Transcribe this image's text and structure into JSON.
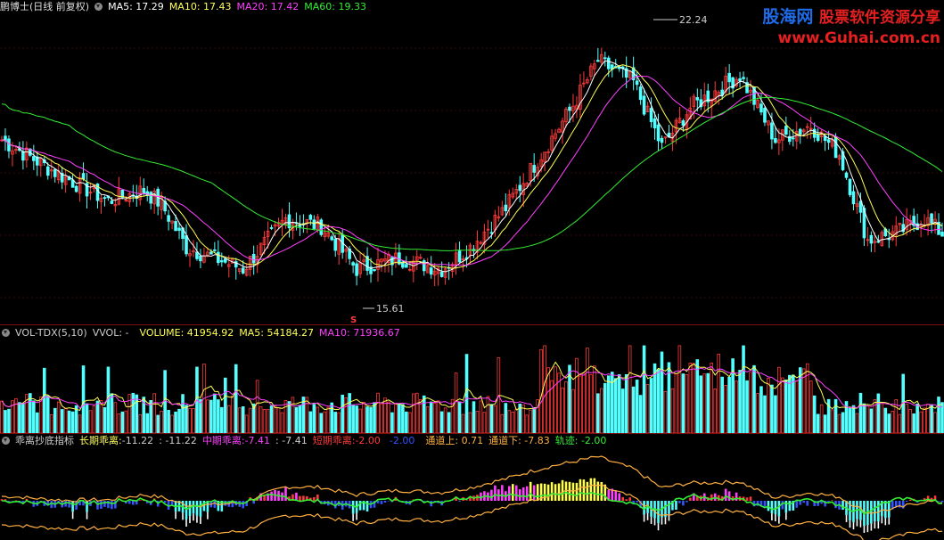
{
  "price_panel": {
    "stock_name": "鹏博士",
    "period": "(日线 前复权)",
    "ma5": "MA5: 17.29",
    "ma10": "MA10: 17.43",
    "ma20": "MA20: 17.42",
    "ma60": "MA60: 19.33",
    "high_label": "22.24",
    "low_label": "15.61",
    "signal_mark": "S",
    "colors": {
      "ma5": "#ffffff",
      "ma10": "#ffff55",
      "ma20": "#ff40ff",
      "ma60": "#33ee33",
      "up": "#ff3a3a",
      "down": "#54ffff"
    }
  },
  "volume_panel": {
    "name": "VOL-TDX(5,10)",
    "vvol": "VVOL: -",
    "volume": "VOLUME: 41954.92",
    "ma5": "MA5: 54184.27",
    "ma10": "MA10: 71936.67"
  },
  "indicator_panel": {
    "name": "乖离抄底指标",
    "long_label": "长期乖离:",
    "long_value": "-11.22",
    "colon_value": ": -11.22",
    "mid_label": "中期乖离:",
    "mid_value": "-7.41",
    "mid_colon_value": ": -7.41",
    "short_label": "短期乖离:",
    "short_value": "-2.00",
    "short_colon_value": "-2.00",
    "channel_up": "通道上: 0.71",
    "channel_down": "通道下: -7.83",
    "track": "轨迹: -2.00"
  },
  "watermark": {
    "brand": "股海网",
    "slogan": "股票软件资源分享",
    "url": "www.Guhai.com.cn"
  }
}
